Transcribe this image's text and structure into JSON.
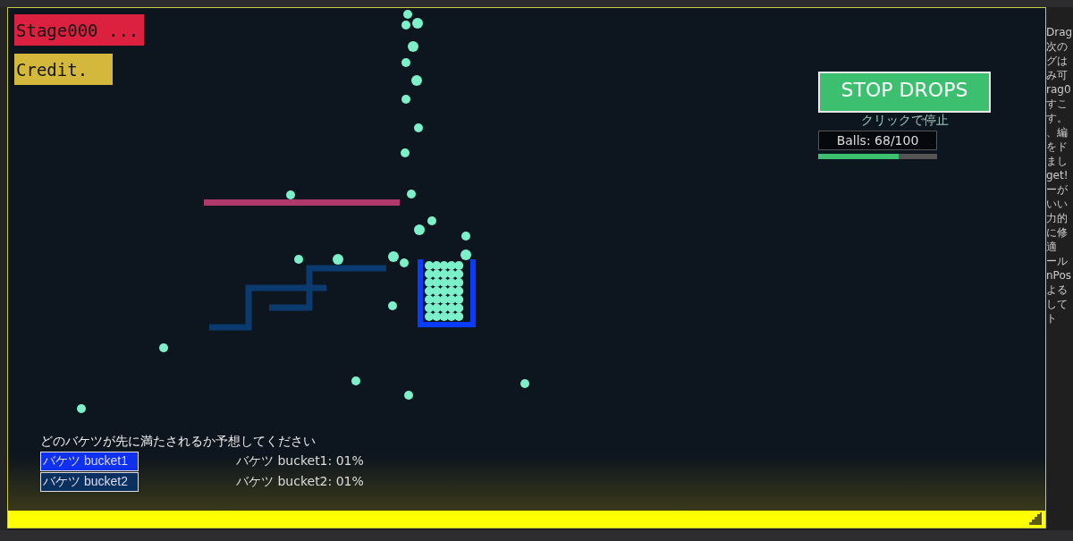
{
  "stage_button": {
    "label": "Stage000 ..."
  },
  "credit_button": {
    "label": "Credit."
  },
  "stop_button": {
    "label": "STOP DROPS",
    "subtitle": "クリックで停止"
  },
  "balls_counter": {
    "text": "Balls: 68/100",
    "level": 0.68
  },
  "prompt": "どのバケツが先に満たされるか予想してください",
  "buckets": [
    {
      "label": "バケツ bucket1",
      "selected": true
    },
    {
      "label": "バケツ bucket2",
      "selected": false
    }
  ],
  "bucket_stats": [
    "バケツ bucket1: 01%",
    "バケツ bucket2: 01%"
  ],
  "side_panel_fragments": [
    "Drag",
    "次の",
    "グは",
    "み可",
    "rag0",
    "すこ",
    "す。",
    "、編",
    "をド",
    "まし",
    "get!",
    "ーが",
    "いい",
    "力的",
    "に修",
    "適",
    "ール",
    "nPos",
    "よる",
    "して",
    "ト"
  ]
}
